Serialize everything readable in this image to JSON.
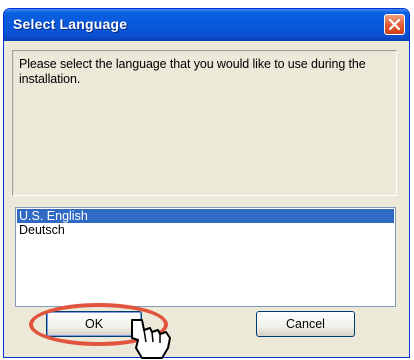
{
  "window": {
    "title": "Select Language"
  },
  "message": "Please select the language that you would like to use during the installation.",
  "languages": {
    "items": [
      "U.S. English",
      "Deutsch"
    ],
    "selected": "U.S. English"
  },
  "buttons": {
    "ok_label": "OK",
    "cancel_label": "Cancel"
  },
  "icons": {
    "close": "close-icon",
    "cursor": "hand-pointer-icon"
  },
  "colors": {
    "titlebar": "#0858dc",
    "selection": "#316ac5",
    "close_button": "#e3582c",
    "highlight": "#e1543d"
  }
}
